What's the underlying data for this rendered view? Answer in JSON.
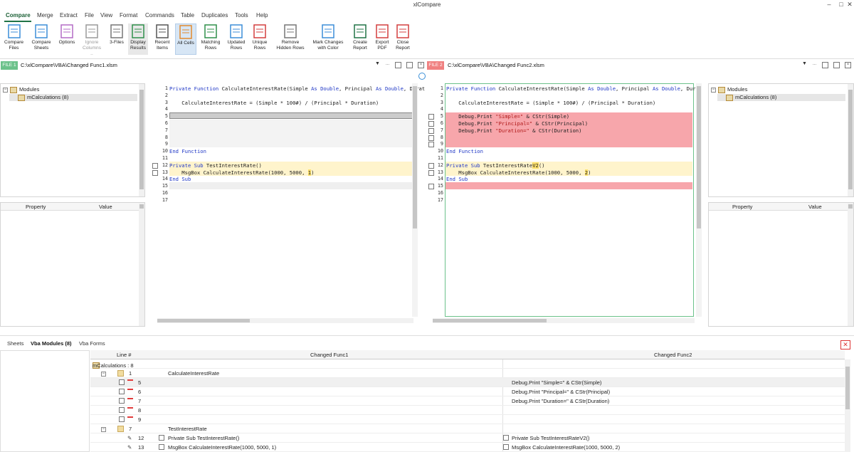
{
  "app": {
    "title": "xlCompare"
  },
  "menu": [
    "Compare",
    "Merge",
    "Extract",
    "File",
    "View",
    "Format",
    "Commands",
    "Table",
    "Duplicates",
    "Tools",
    "Help"
  ],
  "ribbon": [
    {
      "label": "Compare\nFiles",
      "icon": "compare-files-icon"
    },
    {
      "label": "Compare\nSheets",
      "icon": "compare-sheets-icon"
    },
    {
      "label": "Options",
      "icon": "options-icon"
    },
    {
      "label": "Ignore\nColumns ..",
      "icon": "ignore-columns-icon"
    },
    {
      "label": "3-Files",
      "icon": "three-files-icon"
    },
    {
      "label": "Display\nResults",
      "icon": "display-results-icon"
    },
    {
      "label": "Recent\nItems",
      "icon": "recent-items-icon"
    },
    {
      "label": "All Cells",
      "icon": "all-cells-icon"
    },
    {
      "label": "Matching\nRows",
      "icon": "matching-rows-icon"
    },
    {
      "label": "Updated\nRows",
      "icon": "updated-rows-icon"
    },
    {
      "label": "Unique\nRows",
      "icon": "unique-rows-icon"
    },
    {
      "label": "Remove\nHidden Rows",
      "icon": "remove-hidden-rows-icon"
    },
    {
      "label": "Mark Changes\nwith Color",
      "icon": "mark-changes-icon"
    },
    {
      "label": "Create\nReport",
      "icon": "create-report-icon"
    },
    {
      "label": "Export\nPDF",
      "icon": "export-pdf-icon"
    },
    {
      "label": "Close\nReport",
      "icon": "close-report-icon"
    }
  ],
  "file1": {
    "tag": "FILE 1",
    "path": "C:\\xlCompare\\VBA\\Changed Func1.xlsm"
  },
  "file2": {
    "tag": "FILE 2",
    "path": "C:\\xlCompare\\VBA\\Changed Func2.xlsm"
  },
  "tree": {
    "root": "Modules",
    "module": "mCalculations (8)"
  },
  "props": {
    "property": "Property",
    "value": "Value"
  },
  "code_left": [
    {
      "n": "1",
      "t": "Private Function CalculateInterestRate(Simple As Double, Principal As Double, Durat"
    },
    {
      "n": "2",
      "t": ""
    },
    {
      "n": "3",
      "t": "    CalculateInterestRate = (Simple * 100#) / (Principal * Duration)"
    },
    {
      "n": "4",
      "t": ""
    },
    {
      "n": "5",
      "t": ""
    },
    {
      "n": "6",
      "t": ""
    },
    {
      "n": "7",
      "t": ""
    },
    {
      "n": "8",
      "t": ""
    },
    {
      "n": "9",
      "t": ""
    },
    {
      "n": "10",
      "t": "End Function"
    },
    {
      "n": "11",
      "t": ""
    },
    {
      "n": "12",
      "t": "Private Sub TestInterestRate()"
    },
    {
      "n": "13",
      "t": "    MsgBox CalculateInterestRate(1000, 5000, 1)"
    },
    {
      "n": "14",
      "t": "End Sub"
    },
    {
      "n": "15",
      "t": ""
    },
    {
      "n": "16",
      "t": ""
    },
    {
      "n": "17",
      "t": ""
    }
  ],
  "code_right": [
    {
      "n": "1",
      "t": "Private Function CalculateInterestRate(Simple As Double, Principal As Double, Durat"
    },
    {
      "n": "2",
      "t": ""
    },
    {
      "n": "3",
      "t": "    CalculateInterestRate = (Simple * 100#) / (Principal * Duration)"
    },
    {
      "n": "4",
      "t": ""
    },
    {
      "n": "5",
      "t": "    Debug.Print \"Simple=\" & CStr(Simple)"
    },
    {
      "n": "6",
      "t": "    Debug.Print \"Principal=\" & CStr(Principal)"
    },
    {
      "n": "7",
      "t": "    Debug.Print \"Duration=\" & CStr(Duration)"
    },
    {
      "n": "8",
      "t": ""
    },
    {
      "n": "9",
      "t": ""
    },
    {
      "n": "10",
      "t": "End Function"
    },
    {
      "n": "11",
      "t": ""
    },
    {
      "n": "12",
      "t": "Private Sub TestInterestRateV2()"
    },
    {
      "n": "13",
      "t": "    MsgBox CalculateInterestRate(1000, 5000, 2)"
    },
    {
      "n": "14",
      "t": "End Sub"
    },
    {
      "n": "15",
      "t": ""
    },
    {
      "n": "16",
      "t": ""
    },
    {
      "n": "17",
      "t": ""
    }
  ],
  "bottom": {
    "tabs": [
      "Sheets",
      "Vba Modules (8)",
      "Vba Forms"
    ],
    "headers": {
      "line": "Line #",
      "left": "Changed Func1",
      "right": "Changed Func2"
    },
    "root": "mCalculations : 8",
    "rows": [
      {
        "kind": "group",
        "num": "1",
        "left": "CalculateInterestRate",
        "right": ""
      },
      {
        "kind": "removed",
        "num": "5",
        "left": "",
        "right": "Debug.Print \"Simple=\" & CStr(Simple)"
      },
      {
        "kind": "removed",
        "num": "6",
        "left": "",
        "right": "Debug.Print \"Principal=\" & CStr(Principal)"
      },
      {
        "kind": "removed",
        "num": "7",
        "left": "",
        "right": "Debug.Print \"Duration=\" & CStr(Duration)"
      },
      {
        "kind": "removed",
        "num": "8",
        "left": "",
        "right": ""
      },
      {
        "kind": "removed",
        "num": "9",
        "left": "",
        "right": ""
      },
      {
        "kind": "group",
        "num": "7",
        "left": "TestInterestRate",
        "right": ""
      },
      {
        "kind": "changed",
        "num": "12",
        "left": "Private Sub TestInterestRate()",
        "right": "Private Sub TestInterestRateV2()"
      },
      {
        "kind": "changed",
        "num": "13",
        "left": "MsgBox CalculateInterestRate(1000, 5000, 1)",
        "right": "MsgBox CalculateInterestRate(1000, 5000, 2)"
      }
    ]
  },
  "colors": {
    "accent": "#217346",
    "file1": "#6cc28b",
    "file2": "#f08080",
    "diff_red": "#f7a6ab",
    "diff_yellow": "#fff4cc",
    "changed_word": "#ffe16b"
  }
}
